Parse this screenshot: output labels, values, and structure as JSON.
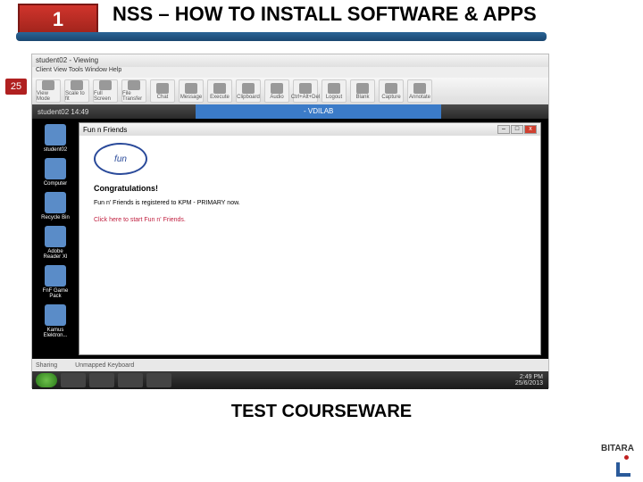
{
  "slide": {
    "number": "1",
    "title": "NSS – HOW TO INSTALL SOFTWARE & APPS",
    "page_badge": "25",
    "caption": "TEST COURSEWARE"
  },
  "brand": {
    "name": "BITARA"
  },
  "viewer": {
    "title": "student02 - Viewing",
    "menus": [
      "Client",
      "View",
      "Tools",
      "Window",
      "Help"
    ],
    "toolbar": [
      "View Mode",
      "Scale to fit",
      "Full Screen",
      "File Transfer",
      "Chat",
      "Message",
      "Execute",
      "Clipboard",
      "Audio",
      "Ctrl+Alt+Del",
      "Logout",
      "Blank",
      "Capture",
      "Annotate"
    ],
    "status": {
      "left": "Sharing",
      "mid": "Unmapped Keyboard"
    }
  },
  "remote": {
    "titlebar_left": "student02   14:49",
    "titlebar_mid": "- VDILAB",
    "desktop_icons": [
      {
        "label": "student02"
      },
      {
        "label": "Computer"
      },
      {
        "label": "Recycle Bin"
      },
      {
        "label": "Adobe Reader XI"
      },
      {
        "label": "FnF Game Pack"
      },
      {
        "label": "Kamus Elektron..."
      }
    ],
    "taskbar": {
      "time": "2:49 PM",
      "date": "25/6/2013"
    }
  },
  "dialog": {
    "title": "Fun n Friends",
    "logo_text": "fun",
    "heading": "Congratulations!",
    "body": "Fun n' Friends is registered to KPM - PRIMARY now.",
    "link": "Click here to start Fun n' Friends."
  }
}
